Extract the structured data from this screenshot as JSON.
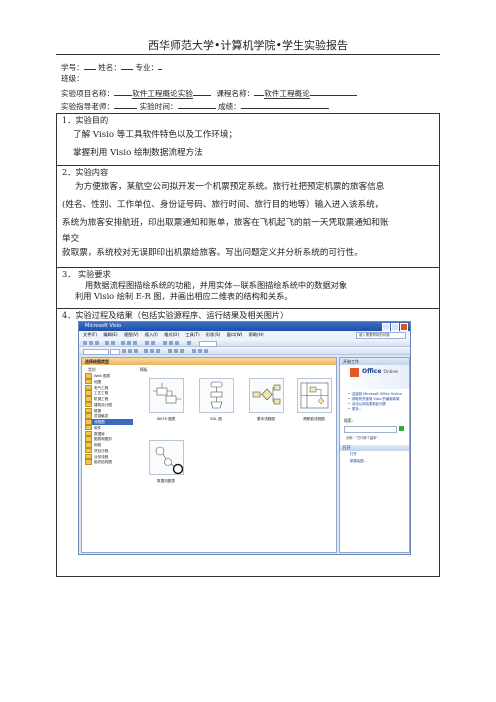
{
  "header": {
    "title": "西华师范大学•计算机学院•学生实验报告"
  },
  "info": {
    "student_id_label": "学号：",
    "name_label": "姓名：",
    "major_label": "专业：",
    "class_label": "班级：",
    "project_label": "实验项目名称：",
    "project_value": "软件工程概论实验",
    "course_label": "课程名称：",
    "course_value": "软件工程概论",
    "teacher_label": "实验指导老师：",
    "time_label": "实验时间：",
    "score_label": "成绩："
  },
  "sections": {
    "s1": {
      "heading": "1．实验目的",
      "lines": [
        "了解 Visio 等工具软件特色以及工作环境；",
        "掌握利用 Visio 绘制数据流程方法"
      ]
    },
    "s2": {
      "heading": "2．实验内容",
      "lines": [
        "为方便旅客，某航空公司拟开发一个机票预定系统。旅行社把预定机票的旅客信息",
        "(姓名、性别、工作单位、身份证号码、旅行时间、旅行目的地等）输入进入该系统，",
        "系统为旅客安排航班，印出取票通知和账单，旅客在飞机起飞的前一天凭取票通知和账",
        "单交",
        "款取票，系统校对无误即印出机票给旅客。写出问题定义并分析系统的可行性。"
      ]
    },
    "s3": {
      "heading": "3．  实验要求",
      "lines": [
        "用数据流程图描绘系统的功能，并用实体—联系图描绘系统中的数据对象",
        "利用 Visio 绘制 E-R 图，并画出相应二维表的结构和关系。"
      ]
    },
    "s4": {
      "heading": "4．实验过程及结果（包括实验源程序、运行结果及相关图片）"
    }
  },
  "visio": {
    "window_title": "Microsoft Visio",
    "menu": [
      "文件(F)",
      "编辑(E)",
      "视图(V)",
      "插入(I)",
      "格式(O)",
      "工具(T)",
      "形状(S)",
      "窗口(W)",
      "帮助(H)"
    ],
    "help_placeholder": "键入需要帮助的问题",
    "left_title": "选择绘图类型",
    "col_category": "类别",
    "col_template": "模板",
    "categories": [
      "Web 图表",
      "地图",
      "电气工程",
      "工艺工程",
      "机械工程",
      "建筑设计图",
      "框图",
      "灵感触发",
      "流程图",
      "软件",
      "数据库",
      "图表和图形",
      "网络",
      "项目日程",
      "业务流程",
      "组织结构图"
    ],
    "selected_category": "流程图",
    "templates": [
      "IDEF0 图表",
      "SDL 图",
      "基本流程图",
      "跨职能流程图",
      "数据流图表"
    ],
    "right_title": "开始工作",
    "office_brand": "Office",
    "office_online": "Online",
    "links": [
      "连接到 Microsoft Office Online",
      "获取有关使用 Visio 的最新新闻",
      "自动从网站更新此列表"
    ],
    "more": "更多...",
    "search_label": "搜索:",
    "search_hint": "示例：“打印多个副本”",
    "open_title": "打开",
    "open_items": [
      "打开",
      "新建绘图..."
    ]
  }
}
